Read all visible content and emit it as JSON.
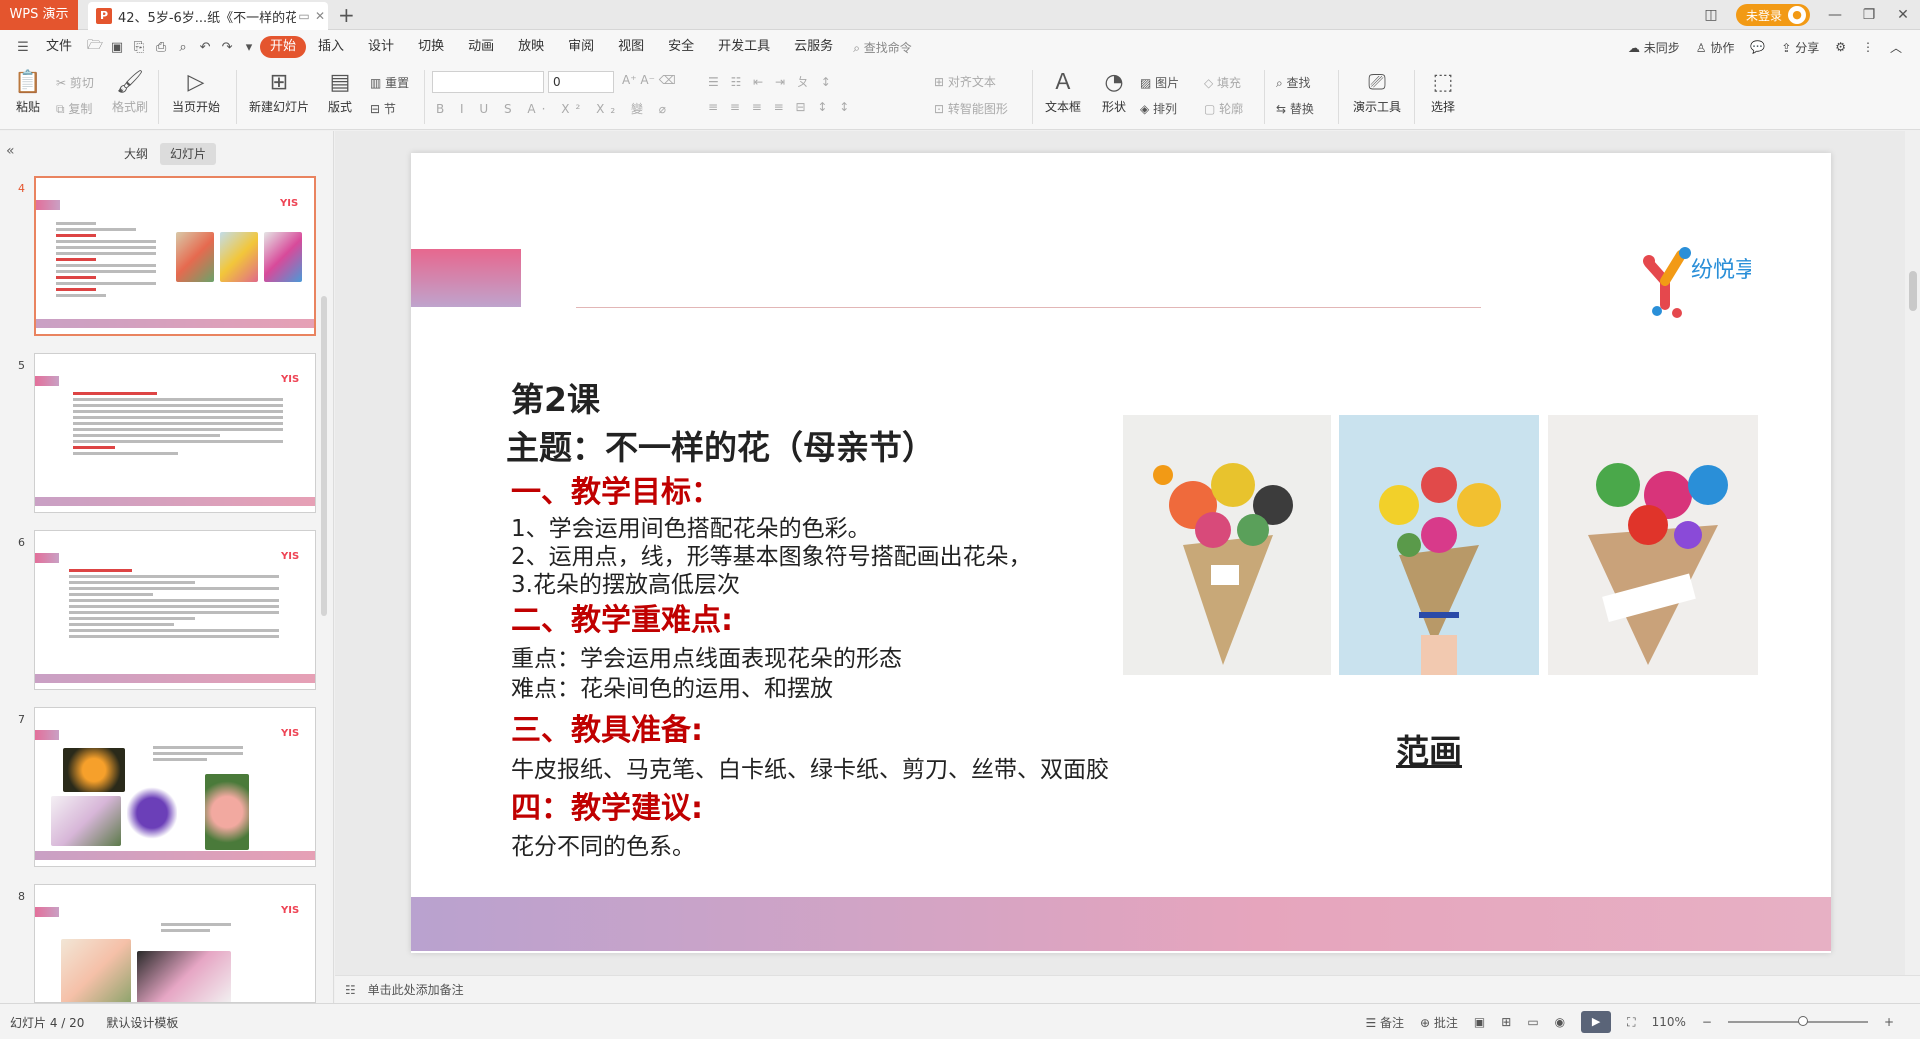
{
  "titlebar": {
    "app_name": "WPS 演示",
    "doc_title": "42、5岁-6岁...纸《不一样的花》",
    "login_label": "未登录"
  },
  "menubar": {
    "file_label": "文件",
    "tabs": [
      "开始",
      "插入",
      "设计",
      "切换",
      "动画",
      "放映",
      "审阅",
      "视图",
      "安全",
      "开发工具",
      "云服务"
    ],
    "active_tab": "开始",
    "search_label": "查找命令",
    "right_items": [
      "未同步",
      "协作",
      "分享"
    ]
  },
  "ribbon": {
    "paste": "粘贴",
    "cut": "剪切",
    "copy": "复制",
    "format_painter": "格式刷",
    "from_current": "当页开始",
    "new_slide": "新建幻灯片",
    "layout": "版式",
    "section": "节",
    "reset": "重置",
    "font_size": "0",
    "align_text": "对齐文本",
    "smart_shape": "转智能图形",
    "textbox": "文本框",
    "shape": "形状",
    "picture": "图片",
    "arrange": "排列",
    "fill": "填充",
    "outline": "轮廓",
    "find": "查找",
    "replace": "替换",
    "presentation_tools": "演示工具",
    "select": "选择"
  },
  "leftpanel": {
    "tab_outline": "大纲",
    "tab_slides": "幻灯片",
    "thumbs": [
      {
        "num": "4",
        "selected": true
      },
      {
        "num": "5",
        "selected": false
      },
      {
        "num": "6",
        "selected": false
      },
      {
        "num": "7",
        "selected": false
      },
      {
        "num": "8",
        "selected": false
      }
    ]
  },
  "slide": {
    "lesson": "第2课",
    "topic": "主题：不一样的花（母亲节）",
    "sections": [
      {
        "heading": "一、教学目标：",
        "lines": [
          "1、学会运用间色搭配花朵的色彩。",
          "2、运用点，线，形等基本图象符号搭配画出花朵，",
          "3.花朵的摆放高低层次"
        ]
      },
      {
        "heading": "二、教学重难点:",
        "lines": [
          "重点：学会运用点线面表现花朵的形态",
          "难点：花朵间色的运用、和摆放"
        ]
      },
      {
        "heading": "三、教具准备:",
        "lines": [
          "牛皮报纸、马克笔、白卡纸、绿卡纸、剪刀、丝带、双面胶"
        ]
      },
      {
        "heading": "四：教学建议:",
        "lines": [
          "花分不同的色系。"
        ]
      }
    ],
    "caption": "范画",
    "logo_text": "纷悦享",
    "colors": {
      "heading_red": "#c00000",
      "accent_pink": "#e7678e",
      "accent_purple": "#b9a2cf"
    }
  },
  "notes": {
    "placeholder": "单击此处添加备注"
  },
  "statusbar": {
    "slide_counter": "幻灯片 4 / 20",
    "template": "默认设计模板",
    "notes_btn": "备注",
    "comments_btn": "批注",
    "zoom": "110%"
  }
}
